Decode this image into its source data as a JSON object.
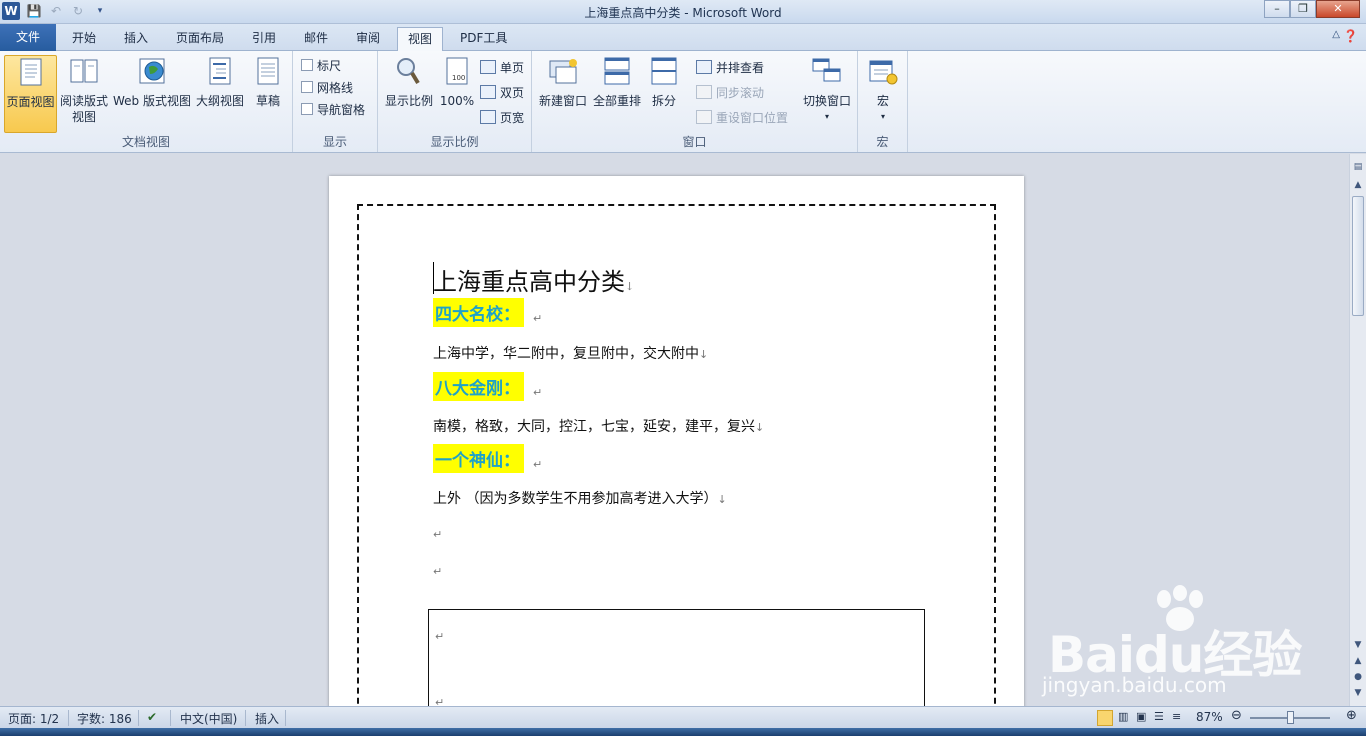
{
  "window": {
    "title": "上海重点高中分类  -  Microsoft Word"
  },
  "qat": {
    "app_icon": "W"
  },
  "tabs": [
    "文件",
    "开始",
    "插入",
    "页面布局",
    "引用",
    "邮件",
    "审阅",
    "视图",
    "PDF工具"
  ],
  "active_tab": "视图",
  "ribbon": {
    "doc_views": {
      "label": "文档视图",
      "print_layout": "页面视图",
      "reading_line1": "阅读版式",
      "reading_line2": "视图",
      "web_layout": "Web 版式视图",
      "outline": "大纲视图",
      "draft": "草稿"
    },
    "show": {
      "label": "显示",
      "ruler": "标尺",
      "gridlines": "网格线",
      "nav_pane": "导航窗格"
    },
    "zoom": {
      "label": "显示比例",
      "zoom": "显示比例",
      "hundred": "100%",
      "one_page": "单页",
      "two_pages": "双页",
      "page_width": "页宽"
    },
    "window": {
      "label": "窗口",
      "new_window": "新建窗口",
      "arrange_all": "全部重排",
      "split": "拆分",
      "side_by_side": "并排查看",
      "sync_scroll": "同步滚动",
      "reset_position": "重设窗口位置",
      "switch_windows": "切换窗口"
    },
    "macros": {
      "label": "宏",
      "macros": "宏"
    }
  },
  "document": {
    "title": "上海重点高中分类",
    "heading1": "四大名校：",
    "line1": "上海中学，华二附中，复旦附中，交大附中",
    "heading2": "八大金刚：",
    "line2": "南模，格致，大同，控江，七宝，延安，建平，复兴",
    "heading3": "一个神仙：",
    "line3": "上外 （因为多数学生不用参加高考进入大学）",
    "para_mark": "↵",
    "line_mark": "↓"
  },
  "status": {
    "page": "页面: 1/2",
    "words": "字数: 186",
    "language": "中文(中国)",
    "mode": "插入",
    "zoom": "87%"
  },
  "watermark": {
    "brand": "Baidu经验",
    "url": "jingyan.baidu.com"
  },
  "colors": {
    "highlight": "#ffff00",
    "heading_text": "#1fa2c8",
    "file_tab": "#2b5797"
  }
}
